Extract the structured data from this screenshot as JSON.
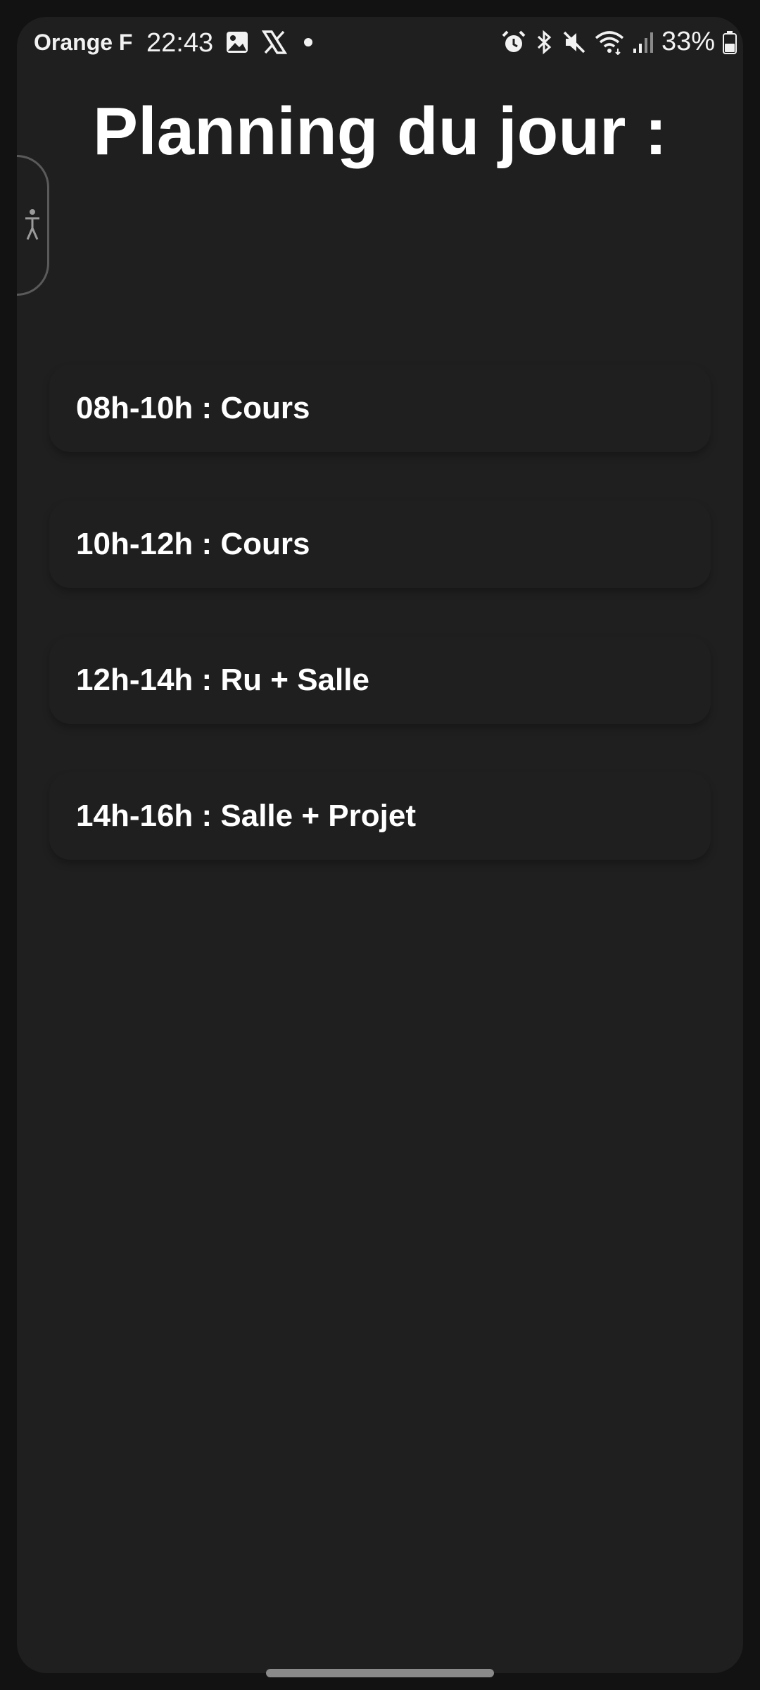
{
  "status_bar": {
    "carrier": "Orange F",
    "time": "22:43",
    "battery_percent": "33%",
    "left_icons": [
      "gallery-icon",
      "x-icon",
      "dot-icon"
    ],
    "right_icons": [
      "alarm-icon",
      "bluetooth-icon",
      "mute-icon",
      "wifi-icon",
      "signal-icon",
      "battery-icon"
    ]
  },
  "page": {
    "title": "Planning du jour :"
  },
  "schedule": {
    "items": [
      {
        "label": "08h-10h : Cours"
      },
      {
        "label": "10h-12h : Cours"
      },
      {
        "label": "12h-14h : Ru + Salle"
      },
      {
        "label": "14h-16h : Salle + Projet"
      }
    ]
  },
  "colors": {
    "background": "#1f1f1f",
    "outer": "#121212",
    "text": "#ffffff"
  }
}
